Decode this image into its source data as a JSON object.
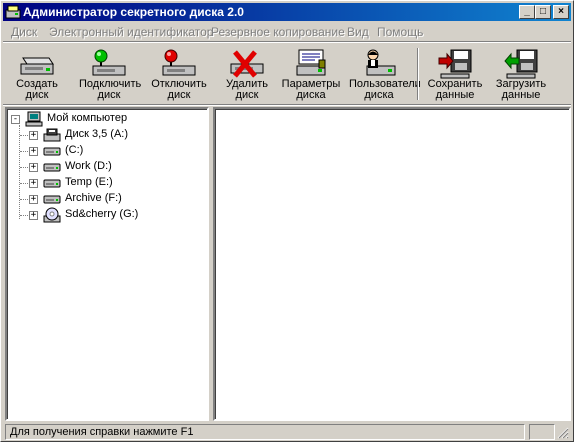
{
  "window": {
    "title": "Администратор секретного диска 2.0",
    "controls": {
      "minimize": "_",
      "maximize": "□",
      "close": "×"
    }
  },
  "menu": [
    "Диск",
    "Электронный идентификатор",
    "Резервное копирование",
    "Вид",
    "Помощь"
  ],
  "toolbar": {
    "create": {
      "line1": "Создать",
      "line2": "диск",
      "icon": "drive-create-icon"
    },
    "mount": {
      "line1": "Подключить",
      "line2": "диск",
      "icon": "drive-connect-green-icon"
    },
    "unmount": {
      "line1": "Отключить",
      "line2": "диск",
      "icon": "drive-disconnect-red-icon"
    },
    "delete": {
      "line1": "Удалить",
      "line2": "диск",
      "icon": "drive-delete-icon"
    },
    "params": {
      "line1": "Параметры",
      "line2": "диска",
      "icon": "disk-parameters-icon"
    },
    "users": {
      "line1": "Пользователи",
      "line2": "диска",
      "icon": "disk-users-icon"
    },
    "save": {
      "line1": "Сохранить",
      "line2": "данные",
      "icon": "save-data-icon"
    },
    "load": {
      "line1": "Загрузить",
      "line2": "данные",
      "icon": "load-data-icon"
    }
  },
  "tree": {
    "root": {
      "label": "Мой компьютер",
      "expander": "-"
    },
    "items": [
      {
        "label": "Диск 3,5 (A:)",
        "expander": "+",
        "icon": "floppy-drive-icon"
      },
      {
        "label": " (C:)",
        "expander": "+",
        "icon": "hard-drive-icon"
      },
      {
        "label": "Work (D:)",
        "expander": "+",
        "icon": "hard-drive-icon"
      },
      {
        "label": "Temp (E:)",
        "expander": "+",
        "icon": "hard-drive-icon"
      },
      {
        "label": "Archive (F:)",
        "expander": "+",
        "icon": "hard-drive-icon"
      },
      {
        "label": "Sd&cherry (G:)",
        "expander": "+",
        "icon": "cd-drive-icon"
      }
    ]
  },
  "status": {
    "text": "Для получения справки нажмите F1"
  },
  "colors": {
    "face": "#d4d0c8",
    "title_start": "#000080",
    "title_end": "#1084d0",
    "green": "#00c000",
    "red": "#e00000"
  }
}
